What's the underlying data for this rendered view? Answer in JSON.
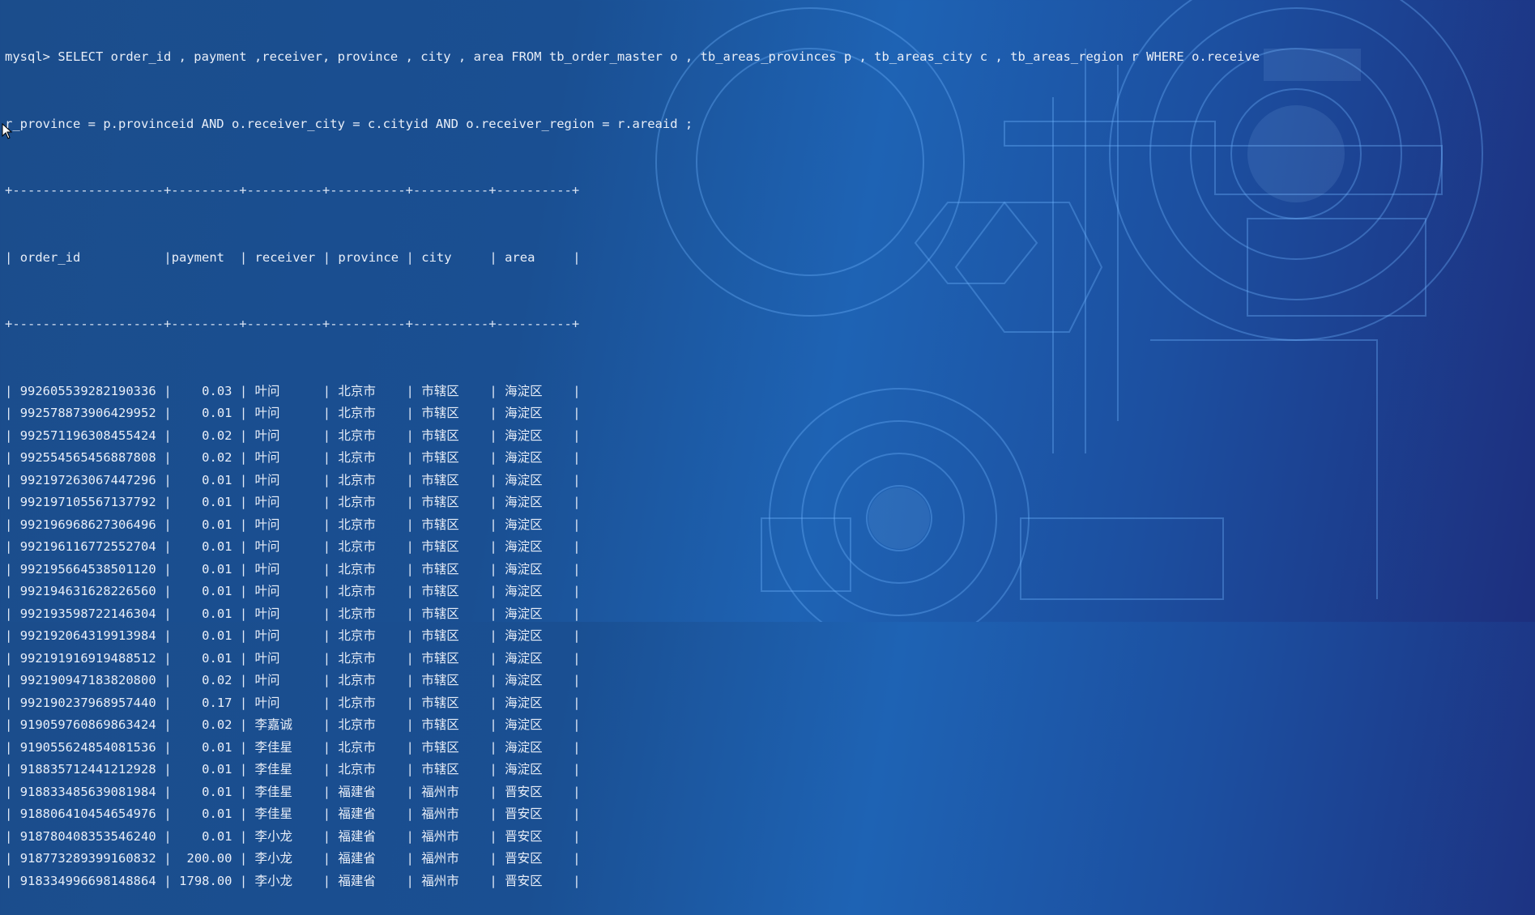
{
  "terminal": {
    "prompt": "mysql>",
    "query_line1": " SELECT order_id , payment ,receiver, province , city , area FROM tb_order_master o , tb_areas_provinces p , tb_areas_city c , tb_areas_region r WHERE o.receive",
    "query_line2": "r_province = p.provinceid AND o.receiver_city = c.cityid AND o.receiver_region = r.areaid ;",
    "separator": "+--------------------+---------+----------+----------+----------+----------+"
  },
  "table": {
    "headers": [
      "order_id",
      "payment",
      "receiver",
      "province",
      "city",
      "area"
    ],
    "rows": [
      [
        "992605539282190336",
        "0.03",
        "叶问",
        "北京市",
        "市辖区",
        "海淀区"
      ],
      [
        "992578873906429952",
        "0.01",
        "叶问",
        "北京市",
        "市辖区",
        "海淀区"
      ],
      [
        "992571196308455424",
        "0.02",
        "叶问",
        "北京市",
        "市辖区",
        "海淀区"
      ],
      [
        "992554565456887808",
        "0.02",
        "叶问",
        "北京市",
        "市辖区",
        "海淀区"
      ],
      [
        "992197263067447296",
        "0.01",
        "叶问",
        "北京市",
        "市辖区",
        "海淀区"
      ],
      [
        "992197105567137792",
        "0.01",
        "叶问",
        "北京市",
        "市辖区",
        "海淀区"
      ],
      [
        "992196968627306496",
        "0.01",
        "叶问",
        "北京市",
        "市辖区",
        "海淀区"
      ],
      [
        "992196116772552704",
        "0.01",
        "叶问",
        "北京市",
        "市辖区",
        "海淀区"
      ],
      [
        "992195664538501120",
        "0.01",
        "叶问",
        "北京市",
        "市辖区",
        "海淀区"
      ],
      [
        "992194631628226560",
        "0.01",
        "叶问",
        "北京市",
        "市辖区",
        "海淀区"
      ],
      [
        "992193598722146304",
        "0.01",
        "叶问",
        "北京市",
        "市辖区",
        "海淀区"
      ],
      [
        "992192064319913984",
        "0.01",
        "叶问",
        "北京市",
        "市辖区",
        "海淀区"
      ],
      [
        "992191916919488512",
        "0.01",
        "叶问",
        "北京市",
        "市辖区",
        "海淀区"
      ],
      [
        "992190947183820800",
        "0.02",
        "叶问",
        "北京市",
        "市辖区",
        "海淀区"
      ],
      [
        "992190237968957440",
        "0.17",
        "叶问",
        "北京市",
        "市辖区",
        "海淀区"
      ],
      [
        "919059760869863424",
        "0.02",
        "李嘉诚",
        "北京市",
        "市辖区",
        "海淀区"
      ],
      [
        "919055624854081536",
        "0.01",
        "李佳星",
        "北京市",
        "市辖区",
        "海淀区"
      ],
      [
        "918835712441212928",
        "0.01",
        "李佳星",
        "北京市",
        "市辖区",
        "海淀区"
      ],
      [
        "918833485639081984",
        "0.01",
        "李佳星",
        "福建省",
        "福州市",
        "晋安区"
      ],
      [
        "918806410454654976",
        "0.01",
        "李佳星",
        "福建省",
        "福州市",
        "晋安区"
      ],
      [
        "918780408353546240",
        "0.01",
        "李小龙",
        "福建省",
        "福州市",
        "晋安区"
      ],
      [
        "918773289399160832",
        "200.00",
        "李小龙",
        "福建省",
        "福州市",
        "晋安区"
      ],
      [
        "918334996698148864",
        "1798.00",
        "李小龙",
        "福建省",
        "福州市",
        "晋安区"
      ]
    ]
  },
  "colors": {
    "text": "#e8eef8",
    "background": "#1e5aa8"
  }
}
